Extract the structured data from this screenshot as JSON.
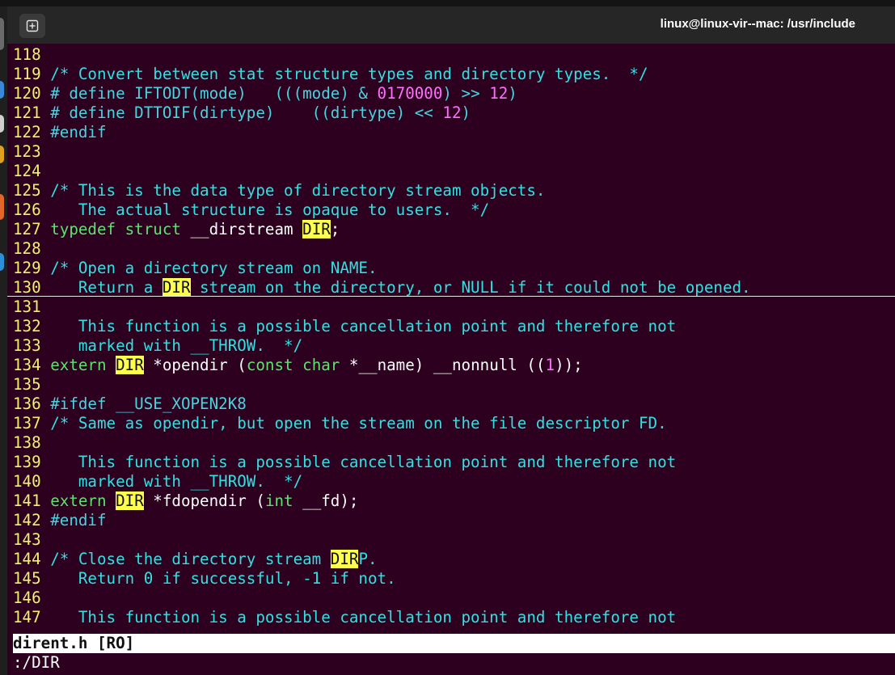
{
  "window": {
    "title": "linux@linux-vir--mac: /usr/include"
  },
  "editor": {
    "lines": [
      {
        "n": "118",
        "parts": []
      },
      {
        "n": "119",
        "parts": [
          {
            "c": "cm",
            "t": "/* Convert between stat structure types and directory types.  */"
          }
        ]
      },
      {
        "n": "120",
        "parts": [
          {
            "c": "pp",
            "t": "# define IFTODT(mode)   (((mode) & "
          },
          {
            "c": "nm",
            "t": "0170000"
          },
          {
            "c": "pp",
            "t": ") >> "
          },
          {
            "c": "nm",
            "t": "12"
          },
          {
            "c": "pp",
            "t": ")"
          }
        ]
      },
      {
        "n": "121",
        "parts": [
          {
            "c": "pp",
            "t": "# define DTTOIF(dirtype)    ((dirtype) << "
          },
          {
            "c": "nm",
            "t": "12"
          },
          {
            "c": "pp",
            "t": ")"
          }
        ]
      },
      {
        "n": "122",
        "parts": [
          {
            "c": "pp",
            "t": "#endif"
          }
        ]
      },
      {
        "n": "123",
        "parts": []
      },
      {
        "n": "124",
        "parts": []
      },
      {
        "n": "125",
        "parts": [
          {
            "c": "cm",
            "t": "/* This is the data type of directory stream objects."
          }
        ]
      },
      {
        "n": "126",
        "parts": [
          {
            "c": "cm",
            "t": "   The actual structure is opaque to users.  */"
          }
        ]
      },
      {
        "n": "127",
        "parts": [
          {
            "c": "ty",
            "t": "typedef struct"
          },
          {
            "c": "tx",
            "t": " __dirstream "
          },
          {
            "c": "hl",
            "t": "DIR"
          },
          {
            "c": "tx",
            "t": ";"
          }
        ]
      },
      {
        "n": "128",
        "parts": []
      },
      {
        "n": "129",
        "parts": [
          {
            "c": "cm",
            "t": "/* Open a directory stream on NAME."
          }
        ]
      },
      {
        "n": "130",
        "parts": [
          {
            "c": "cm",
            "t": "   Return a "
          },
          {
            "c": "hl",
            "t": "DIR"
          },
          {
            "c": "cm",
            "t": " stream on the directory, or NULL if it could not be opened."
          }
        ],
        "cursor": true
      },
      {
        "n": "131",
        "parts": []
      },
      {
        "n": "132",
        "parts": [
          {
            "c": "cm",
            "t": "   This function is a possible cancellation point and therefore not"
          }
        ]
      },
      {
        "n": "133",
        "parts": [
          {
            "c": "cm",
            "t": "   marked with __THROW.  */"
          }
        ]
      },
      {
        "n": "134",
        "parts": [
          {
            "c": "ty",
            "t": "extern"
          },
          {
            "c": "tx",
            "t": " "
          },
          {
            "c": "hl",
            "t": "DIR"
          },
          {
            "c": "tx",
            "t": " *opendir ("
          },
          {
            "c": "ty",
            "t": "const char"
          },
          {
            "c": "tx",
            "t": " *__name) __nonnull (("
          },
          {
            "c": "nm",
            "t": "1"
          },
          {
            "c": "tx",
            "t": "));"
          }
        ]
      },
      {
        "n": "135",
        "parts": []
      },
      {
        "n": "136",
        "parts": [
          {
            "c": "pp",
            "t": "#ifdef __USE_XOPEN2K8"
          }
        ]
      },
      {
        "n": "137",
        "parts": [
          {
            "c": "cm",
            "t": "/* Same as opendir, but open the stream on the file descriptor FD."
          }
        ]
      },
      {
        "n": "138",
        "parts": []
      },
      {
        "n": "139",
        "parts": [
          {
            "c": "cm",
            "t": "   This function is a possible cancellation point and therefore not"
          }
        ]
      },
      {
        "n": "140",
        "parts": [
          {
            "c": "cm",
            "t": "   marked with __THROW.  */"
          }
        ]
      },
      {
        "n": "141",
        "parts": [
          {
            "c": "ty",
            "t": "extern"
          },
          {
            "c": "tx",
            "t": " "
          },
          {
            "c": "hl",
            "t": "DIR"
          },
          {
            "c": "tx",
            "t": " *fdopendir ("
          },
          {
            "c": "ty",
            "t": "int"
          },
          {
            "c": "tx",
            "t": " __fd);"
          }
        ]
      },
      {
        "n": "142",
        "parts": [
          {
            "c": "pp",
            "t": "#endif"
          }
        ]
      },
      {
        "n": "143",
        "parts": []
      },
      {
        "n": "144",
        "parts": [
          {
            "c": "cm",
            "t": "/* Close the directory stream "
          },
          {
            "c": "hl",
            "t": "DIR"
          },
          {
            "c": "cm",
            "t": "P."
          }
        ]
      },
      {
        "n": "145",
        "parts": [
          {
            "c": "cm",
            "t": "   Return 0 if successful, -1 if not."
          }
        ]
      },
      {
        "n": "146",
        "parts": []
      },
      {
        "n": "147",
        "parts": [
          {
            "c": "cm",
            "t": "   This function is a possible cancellation point and therefore not"
          }
        ]
      }
    ]
  },
  "statusline": {
    "text": "dirent.h [RO]"
  },
  "cmdline": {
    "text": ":/DIR"
  },
  "colors": {
    "background": "#2c001e",
    "comment": "#33e0e0",
    "line_number": "#f2f26a",
    "type_keyword": "#5fe270",
    "number": "#ff6fff",
    "search_highlight": "#ffff4d"
  },
  "icons": {
    "new_tab": "new-tab-icon"
  }
}
